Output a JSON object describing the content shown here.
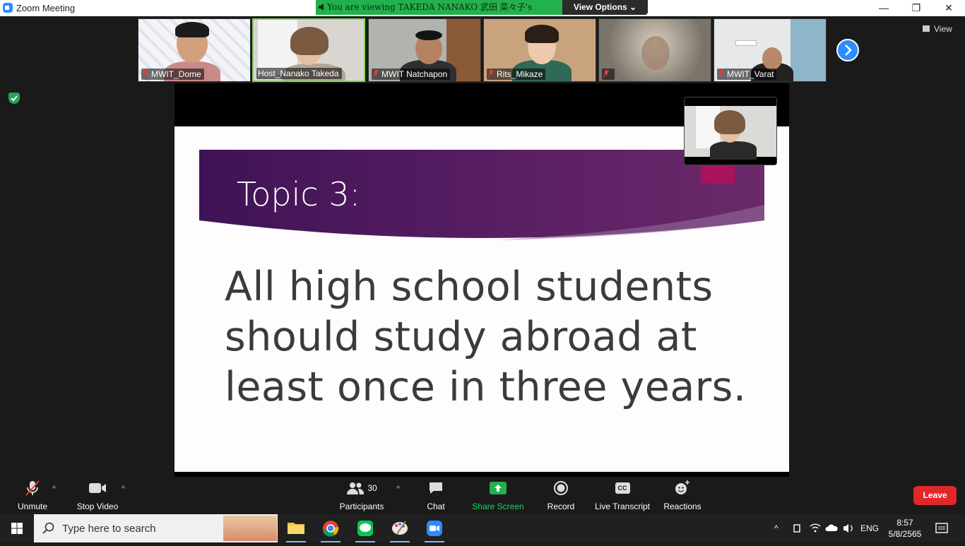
{
  "window": {
    "title": "Zoom Meeting",
    "minimize": "—",
    "restore": "❐",
    "close": "✕"
  },
  "share_banner": {
    "text": "You are viewing TAKEDA NANAKO 武田 菜々子's screen",
    "view_options": "View Options ⌄"
  },
  "gallery": {
    "participants": [
      {
        "name": "MWIT_Dome",
        "muted": true
      },
      {
        "name": "Host_Nanako Takeda",
        "muted": false,
        "active": true
      },
      {
        "name": "MWIT Natchapon",
        "muted": true
      },
      {
        "name": "Rits_Mikaze",
        "muted": true
      },
      {
        "name": "",
        "muted": true
      },
      {
        "name": "MWIT_Varat",
        "muted": true
      }
    ],
    "view_label": "View"
  },
  "slide": {
    "topic": "Topic 3:",
    "statement_lines": [
      "All high school students",
      "should study abroad at",
      "least once in three years."
    ]
  },
  "toolbar": {
    "unmute": "Unmute",
    "stop_video": "Stop Video",
    "participants": "Participants",
    "participants_count": "30",
    "chat": "Chat",
    "share_screen": "Share Screen",
    "record": "Record",
    "live_transcript": "Live Transcript",
    "cc": "CC",
    "reactions": "Reactions",
    "leave": "Leave"
  },
  "taskbar": {
    "search_placeholder": "Type here to search",
    "language": "ENG",
    "time": "8:57",
    "date": "5/8/2565"
  },
  "colors": {
    "zoom_blue": "#2d8cff",
    "share_green": "#23b14d",
    "leave_red": "#e02828",
    "slide_purple": "#5a1e63"
  }
}
